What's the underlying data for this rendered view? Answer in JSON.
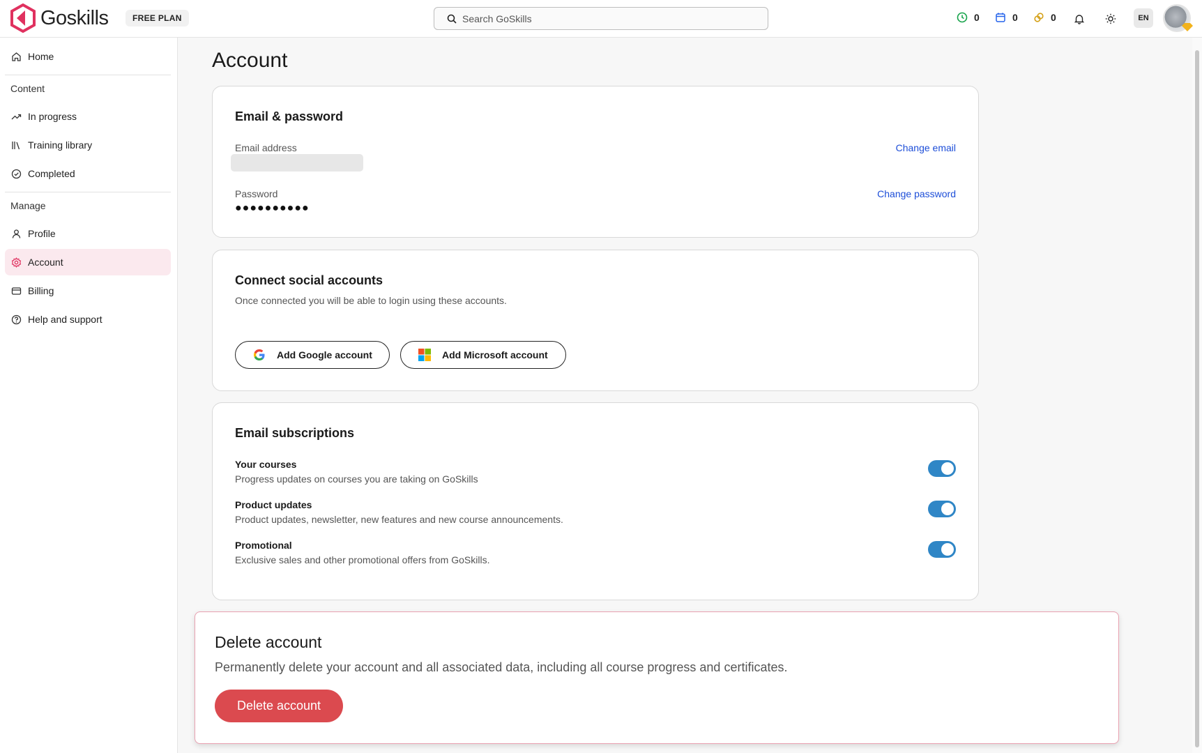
{
  "app": {
    "brand": "Goskills",
    "plan_badge": "FREE PLAN",
    "accent_color": "#e0315f"
  },
  "search": {
    "placeholder": "Search GoSkills"
  },
  "stats": [
    {
      "icon": "clock-icon",
      "value": "0",
      "color": "#16a34a"
    },
    {
      "icon": "calendar-icon",
      "value": "0",
      "color": "#2563eb"
    },
    {
      "icon": "link-icon",
      "value": "0",
      "color": "#d4a017"
    }
  ],
  "header": {
    "language": "EN"
  },
  "sidebar": {
    "home": "Home",
    "content_section": "Content",
    "content_items": [
      "In progress",
      "Training library",
      "Completed"
    ],
    "manage_section": "Manage",
    "manage_items": [
      "Profile",
      "Account",
      "Billing",
      "Help and support"
    ]
  },
  "page": {
    "title": "Account"
  },
  "email_password": {
    "title": "Email & password",
    "email_label": "Email address",
    "change_email": "Change email",
    "password_label": "Password",
    "password_value": "●●●●●●●●●●",
    "change_password": "Change password"
  },
  "social": {
    "title": "Connect social accounts",
    "description": "Once connected you will be able to login using these accounts.",
    "google_button": "Add Google account",
    "microsoft_button": "Add Microsoft account"
  },
  "subscriptions": {
    "title": "Email subscriptions",
    "items": [
      {
        "title": "Your courses",
        "description": "Progress updates on courses you are taking on GoSkills",
        "enabled": true
      },
      {
        "title": "Product updates",
        "description": "Product updates, newsletter, new features and new course announcements.",
        "enabled": true
      },
      {
        "title": "Promotional",
        "description": "Exclusive sales and other promotional offers from GoSkills.",
        "enabled": true
      }
    ],
    "toggle_color": "#2f86c6"
  },
  "delete": {
    "title": "Delete account",
    "description": "Permanently delete your account and all associated data, including all course progress and certificates.",
    "button": "Delete account",
    "button_color": "#db4a4f"
  }
}
